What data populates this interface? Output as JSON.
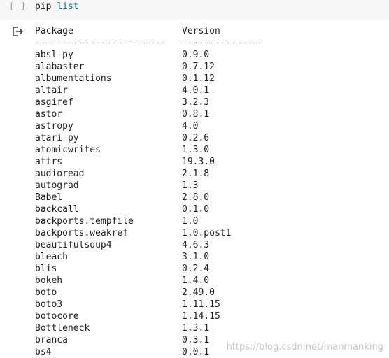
{
  "cell": {
    "run_indicator": "[ ]",
    "command": "pip",
    "argument": "list"
  },
  "output": {
    "header": {
      "package": "Package",
      "version": "Version"
    },
    "separator": {
      "package": "------------------------",
      "version": "---------------"
    },
    "rows": [
      {
        "package": "absl-py",
        "version": "0.9.0"
      },
      {
        "package": "alabaster",
        "version": "0.7.12"
      },
      {
        "package": "albumentations",
        "version": "0.1.12"
      },
      {
        "package": "altair",
        "version": "4.0.1"
      },
      {
        "package": "asgiref",
        "version": "3.2.3"
      },
      {
        "package": "astor",
        "version": "0.8.1"
      },
      {
        "package": "astropy",
        "version": "4.0"
      },
      {
        "package": "atari-py",
        "version": "0.2.6"
      },
      {
        "package": "atomicwrites",
        "version": "1.3.0"
      },
      {
        "package": "attrs",
        "version": "19.3.0"
      },
      {
        "package": "audioread",
        "version": "2.1.8"
      },
      {
        "package": "autograd",
        "version": "1.3"
      },
      {
        "package": "Babel",
        "version": "2.8.0"
      },
      {
        "package": "backcall",
        "version": "0.1.0"
      },
      {
        "package": "backports.tempfile",
        "version": "1.0"
      },
      {
        "package": "backports.weakref",
        "version": "1.0.post1"
      },
      {
        "package": "beautifulsoup4",
        "version": "4.6.3"
      },
      {
        "package": "bleach",
        "version": "3.1.0"
      },
      {
        "package": "blis",
        "version": "0.2.4"
      },
      {
        "package": "bokeh",
        "version": "1.4.0"
      },
      {
        "package": "boto",
        "version": "2.49.0"
      },
      {
        "package": "boto3",
        "version": "1.11.15"
      },
      {
        "package": "botocore",
        "version": "1.14.15"
      },
      {
        "package": "Bottleneck",
        "version": "1.3.1"
      },
      {
        "package": "branca",
        "version": "0.3.1"
      },
      {
        "package": "bs4",
        "version": "0.0.1"
      }
    ]
  },
  "watermark": "https://blog.csdn.net/manmanking",
  "icons": {
    "output": "output-redirect-icon"
  },
  "colors": {
    "input_bg": "#f7f7f7",
    "argument": "#0070c0",
    "text": "#212121"
  }
}
